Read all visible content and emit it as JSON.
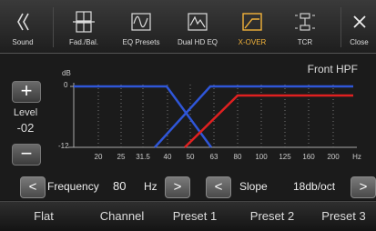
{
  "toolbar": {
    "back_label": "Sound",
    "fad_bal_label": "Fad./Bal.",
    "eq_presets_label": "EQ Presets",
    "dual_hd_eq_label": "Dual HD EQ",
    "xover_label": "X-OVER",
    "tcr_label": "TCR",
    "close_label": "Close",
    "active_color": "#f3b33a"
  },
  "graph": {
    "title": "Front HPF",
    "db_unit": "dB",
    "y_top_label": "0",
    "y_bottom_label": "-12",
    "hz_unit": "Hz",
    "x_ticks": [
      "20",
      "25",
      "31.5",
      "40",
      "50",
      "63",
      "80",
      "100",
      "125",
      "160",
      "200"
    ],
    "active_curve_color": "#e02020",
    "inactive_curve_color": "#2f56d8"
  },
  "level": {
    "plus_label": "+",
    "label": "Level",
    "value": "-02",
    "minus_label": "−"
  },
  "controls": {
    "frequency_label": "Frequency",
    "frequency_value": "80",
    "frequency_unit": "Hz",
    "slope_label": "Slope",
    "slope_value": "18db/oct",
    "left_arrow": "<",
    "right_arrow": ">"
  },
  "presets": {
    "flat": "Flat",
    "channel": "Channel",
    "preset1": "Preset 1",
    "preset2": "Preset 2",
    "preset3": "Preset 3"
  }
}
